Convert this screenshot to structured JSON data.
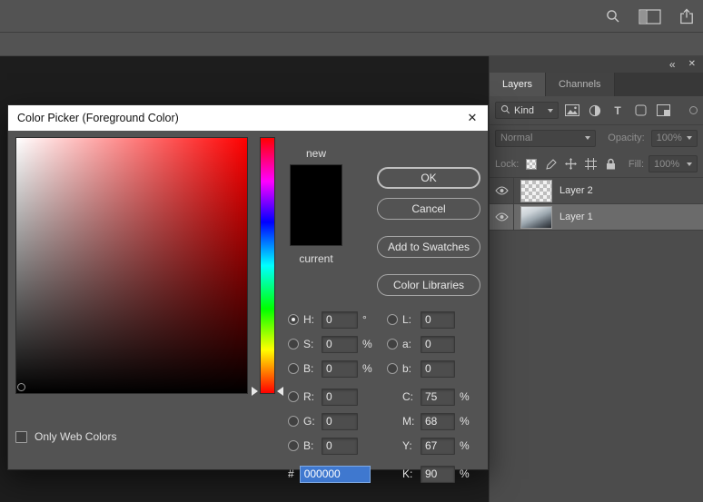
{
  "topbar": {
    "icons": [
      "search-icon",
      "workspace-switcher-icon",
      "share-icon"
    ]
  },
  "panel": {
    "collapse_icon": "«",
    "close_icon": "✕",
    "tabs": [
      {
        "label": "Layers"
      },
      {
        "label": "Channels"
      }
    ],
    "filter": {
      "kind": "Kind"
    },
    "blend": {
      "mode": "Normal",
      "opacity_label": "Opacity:",
      "opacity_value": "100%"
    },
    "lock": {
      "label": "Lock:",
      "fill_label": "Fill:",
      "fill_value": "100%"
    },
    "layers": [
      {
        "name": "Layer 2"
      },
      {
        "name": "Layer 1"
      }
    ]
  },
  "dialog": {
    "title": "Color Picker (Foreground Color)",
    "close": "✕",
    "new_label": "new",
    "current_label": "current",
    "buttons": {
      "ok": "OK",
      "cancel": "Cancel",
      "add_to_swatches": "Add to Swatches",
      "color_libraries": "Color Libraries"
    },
    "fields": {
      "h": {
        "label": "H:",
        "value": "0",
        "unit": "°"
      },
      "s": {
        "label": "S:",
        "value": "0",
        "unit": "%"
      },
      "b": {
        "label": "B:",
        "value": "0",
        "unit": "%"
      },
      "r": {
        "label": "R:",
        "value": "0",
        "unit": ""
      },
      "g": {
        "label": "G:",
        "value": "0",
        "unit": ""
      },
      "b2": {
        "label": "B:",
        "value": "0",
        "unit": ""
      },
      "l": {
        "label": "L:",
        "value": "0",
        "unit": ""
      },
      "a": {
        "label": "a:",
        "value": "0",
        "unit": ""
      },
      "b3": {
        "label": "b:",
        "value": "0",
        "unit": ""
      },
      "c": {
        "label": "C:",
        "value": "75",
        "unit": "%"
      },
      "m": {
        "label": "M:",
        "value": "68",
        "unit": "%"
      },
      "y": {
        "label": "Y:",
        "value": "67",
        "unit": "%"
      },
      "k": {
        "label": "K:",
        "value": "90",
        "unit": "%"
      }
    },
    "hex_label": "#",
    "hex_value": "000000",
    "only_web_colors": "Only Web Colors",
    "colors": {
      "new_swatch": "#000000",
      "current_swatch": "#000000",
      "hex_selection": "#3f78cf",
      "hue": "#ff0000"
    }
  }
}
